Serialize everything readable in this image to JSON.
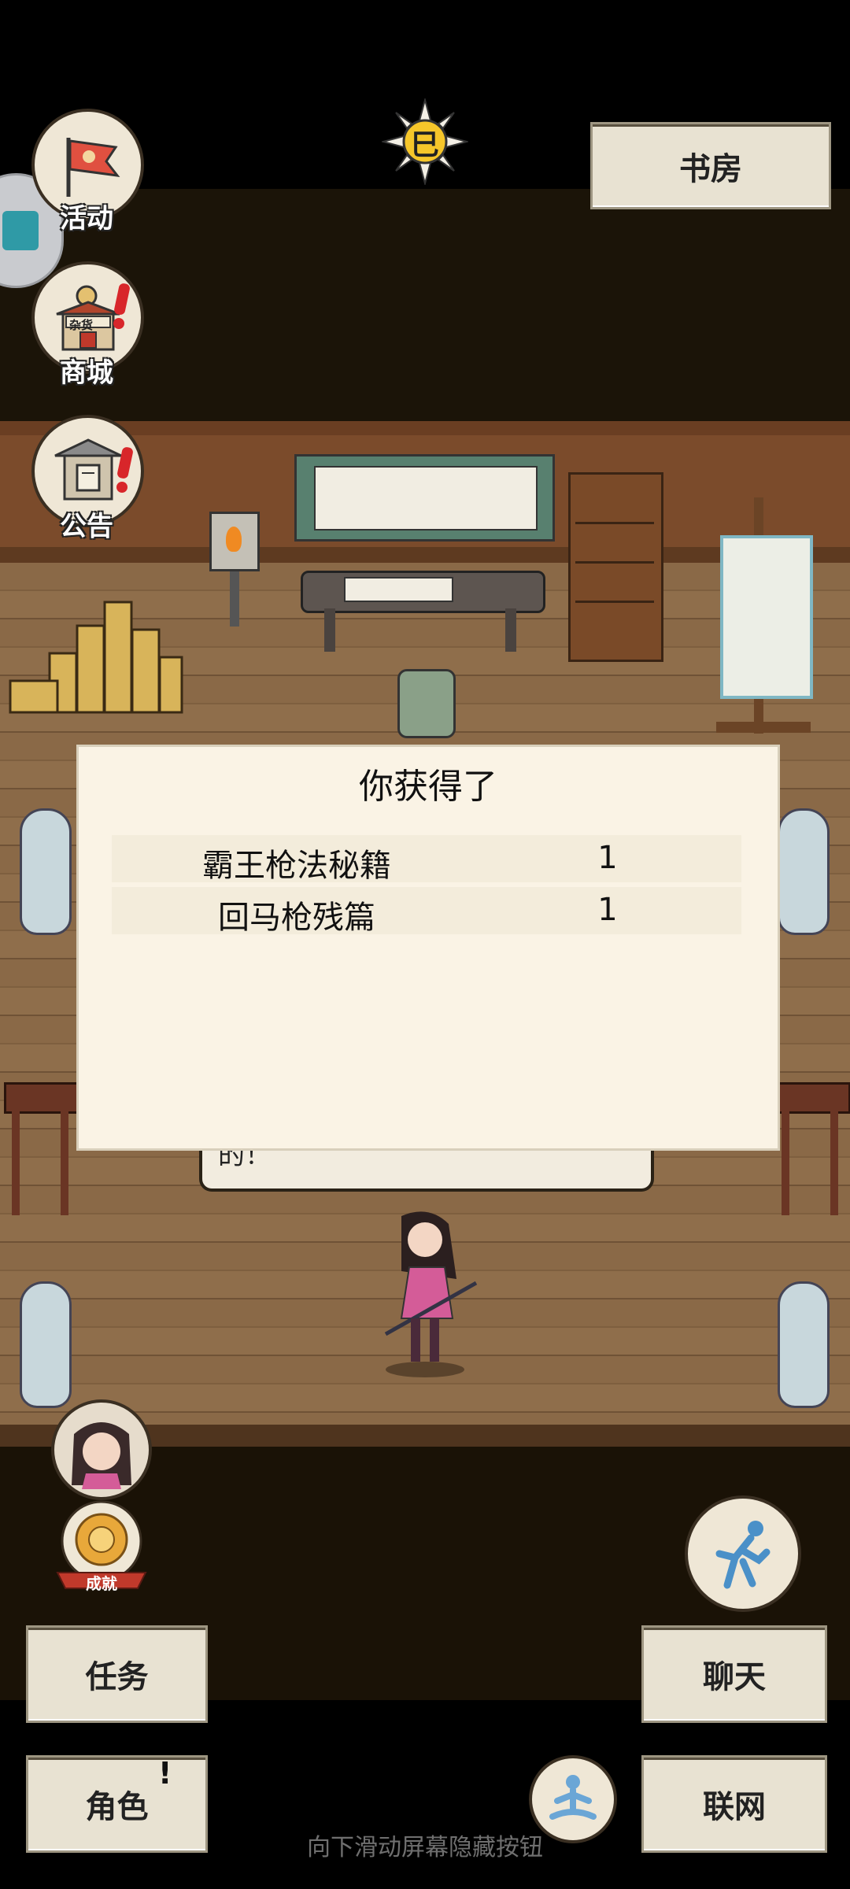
{
  "scene": {
    "location_label": "书房",
    "time_glyph": "巳"
  },
  "left_menu": {
    "activity_label": "活动",
    "shop_label": "商城",
    "shop_sign": "杂货",
    "notice_label": "公告"
  },
  "achievement": {
    "label": "成就"
  },
  "reward_dialog": {
    "title": "你获得了",
    "items": [
      {
        "name": "霸王枪法秘籍",
        "qty": "1"
      },
      {
        "name": "回马枪残篇",
        "qty": "1"
      }
    ]
  },
  "speech_bubble": {
    "text": "的！"
  },
  "bottom_bar": {
    "quest_label": "任务",
    "chat_label": "聊天",
    "character_label": "角色",
    "character_badge": "!",
    "online_label": "联网"
  },
  "hint_text": "向下滑动屏幕隐藏按钮",
  "colors": {
    "dialog_bg": "#faf3e5",
    "button_paper": "#e8e2d2",
    "floor": "#8a6947",
    "alert_red": "#d8262a"
  }
}
